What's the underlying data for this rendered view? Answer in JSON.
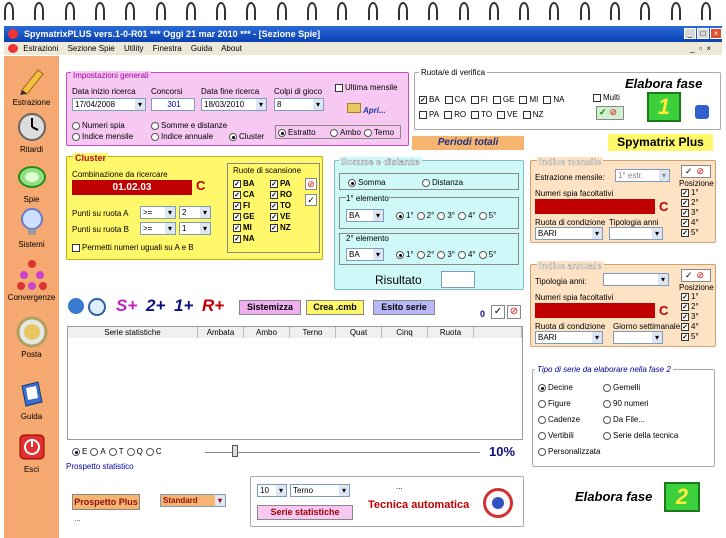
{
  "window": {
    "title": "SpymatrixPLUS vers.1-0-R01  ***  Oggi 21 mar 2010  ***  - [Sezione Spie]"
  },
  "menu": [
    "Estrazioni",
    "Sezione Spie",
    "Utility",
    "Finestra",
    "Guida",
    "About"
  ],
  "sidebar": [
    {
      "label": "Estrazione",
      "icon": "pencil-icon"
    },
    {
      "label": "Ritardi",
      "icon": "clock-icon"
    },
    {
      "label": "Spie",
      "icon": "flashlight-icon"
    },
    {
      "label": "Sistemi",
      "icon": "lightbulb-icon"
    },
    {
      "label": "Convergenze",
      "icon": "network-icon"
    },
    {
      "label": "Posta",
      "icon": "coin-icon"
    },
    {
      "label": "Guida",
      "icon": "book-icon"
    },
    {
      "label": "Esci",
      "icon": "exit-icon"
    }
  ],
  "impostazioni": {
    "title": "Impostazioni generali",
    "data_inizio_label": "Data inizio ricerca",
    "data_inizio": "17/04/2008",
    "concorsi_label": "Concorsi",
    "concorsi": "301",
    "data_fine_label": "Data fine ricerca",
    "data_fine": "18/03/2010",
    "colpi_label": "Colpi di gioco",
    "colpi": "8",
    "ultima_mensile": "Ultima mensile",
    "apri": "Apri...",
    "numeri_spia": "Numeri spia",
    "somme": "Somme e distanze",
    "ind_mensile": "Indice mensile",
    "ind_annuale": "Indice annuale",
    "cluster": "Cluster",
    "estratto": "Estratto",
    "ambo": "Ambo",
    "terno": "Terno"
  },
  "ruote_verifica": {
    "title": "Ruota/e di verifica",
    "row1": [
      "BA",
      "CA",
      "FI",
      "GE",
      "MI",
      "NA"
    ],
    "row2": [
      "PA",
      "RO",
      "TO",
      "VE",
      "NZ"
    ],
    "multi": "Multi",
    "elabora": "Elabora fase",
    "fase": "1"
  },
  "periodi": "Periodi totali",
  "brand": "Spymatrix Plus",
  "cluster": {
    "title": "Cluster",
    "comb_label": "Combinazione da ricercare",
    "comb": "01.02.03",
    "c": "C",
    "punti_a": "Punti su ruota A",
    "punti_b": "Punti su ruota B",
    "op_a": ">=",
    "val_a": "2",
    "op_b": ">=",
    "val_b": "1",
    "permetti": "Permetti numeri uguali su A e B",
    "ruote_title": "Ruote di scansione",
    "ruote_col1": [
      "BA",
      "CA",
      "FI",
      "GE",
      "MI",
      "NA"
    ],
    "ruote_col2": [
      "PA",
      "RO",
      "TO",
      "VE",
      "NZ"
    ]
  },
  "somme": {
    "title": "Somme e distanze",
    "somma": "Somma",
    "distanza": "Distanza",
    "el1": "1° elemento",
    "el2": "2° elemento",
    "ruota": "BA",
    "pos": [
      "1°",
      "2°",
      "3°",
      "4°",
      "5°"
    ],
    "risultato": "Risultato"
  },
  "mensile": {
    "title": "Indice mensile",
    "estr_label": "Estrazione mensile:",
    "estr_val": "1° estr.",
    "numeri_label": "Numeri spia facoltativi",
    "c": "C",
    "ruota_label": "Ruota di condizione",
    "tip_label": "Tipologia anni",
    "ruota": "BARI",
    "posizione": "Posizione",
    "pos": [
      "1°",
      "2°",
      "3°",
      "4°",
      "5°"
    ]
  },
  "annuale": {
    "title": "Indice annuale",
    "tip_label": "Tipologia anni:",
    "numeri_label": "Numeri spia facoltativi",
    "c": "C",
    "ruota_label": "Ruota di condizione",
    "giorno_label": "Giorno settimanale",
    "ruota": "BARI",
    "posizione": "Posizione",
    "pos": [
      "1°",
      "2°",
      "3°",
      "4°",
      "5°"
    ]
  },
  "toolbar": {
    "splus": "S+",
    "two": "2+",
    "one": "1+",
    "rplus": "R+",
    "sistemizza": "Sistemizza",
    "crea": "Crea .cmb",
    "esito": "Esito serie",
    "zero": "0"
  },
  "table": {
    "headers": [
      "Serie statistiche",
      "Ambata",
      "Ambo",
      "Terno",
      "Quat",
      "Cinq",
      "Ruota"
    ]
  },
  "filters": {
    "opts": [
      "E",
      "A",
      "T",
      "Q",
      "C"
    ],
    "pct": "10%"
  },
  "prospetto": "Prospetto statistico",
  "tipo_serie": {
    "title": "Tipo di serie da elaborare nella fase 2",
    "left": [
      "Decine",
      "Figure",
      "Cadenze",
      "Vertibili",
      "Personalizzata"
    ],
    "right": [
      "Gemelli",
      "90 numeri",
      "Da File...",
      "Serie della tecnica"
    ]
  },
  "bottom": {
    "prospetto_plus": "Prospetto Plus",
    "standard": "Standard",
    "dots": "...",
    "num": "10",
    "sorte": "Terno",
    "dots2": "...",
    "serie_btn": "Serie statistiche",
    "tecnica": "Tecnica automatica",
    "elabora": "Elabora fase",
    "fase": "2"
  },
  "colors": {
    "pink": "#f7c8f2",
    "yellow": "#fff86a",
    "cyan": "#cff8f8",
    "peach": "#fde3c4",
    "orange": "#f5a970",
    "red": "#c00000",
    "green": "#44dd44"
  }
}
